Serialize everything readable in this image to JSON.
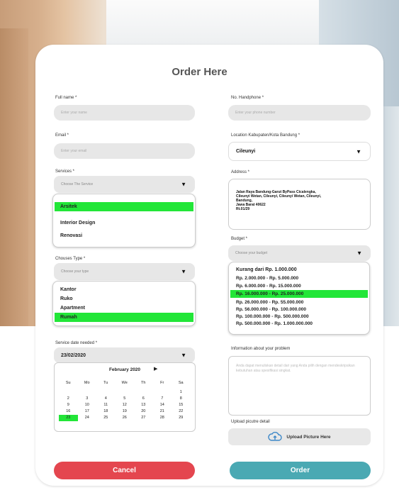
{
  "form": {
    "title": "Order Here",
    "full_name": {
      "label": "Full name *",
      "placeholder": "Enter your name"
    },
    "phone": {
      "label": "No. Handphone *",
      "placeholder": "Enter your phone number"
    },
    "email": {
      "label": "Email *",
      "placeholder": "Enter your email"
    },
    "location": {
      "label": "Location Kabupaten/Kota Bandung *",
      "value": "Cileunyi"
    },
    "services": {
      "label": "Services *",
      "placeholder": "Choose The Service",
      "options": [
        "Arsitek",
        "Interior Design",
        "Renovasi"
      ],
      "selected": "Arsitek"
    },
    "address": {
      "label": "Address *",
      "lines": [
        "Jalan Raya Bandung-Garut ByPass Cicalengka,",
        "Cileunyi Wetan, Cileunyi, Cileunyi Wetan, Cileunyi,",
        "Bandung,",
        "Jawa Barat 40622",
        "Rt.01/29"
      ]
    },
    "budget": {
      "label": "Budget *",
      "placeholder": "Choose your budget",
      "options": [
        "Kurang dari Rp. 1.000.000",
        "Rp. 2.000.000 - Rp. 5.000.000",
        "Rp. 6.000.000 - Rp. 15.000.000",
        "Rp. 16.000.000 - Rp. 25.000.000",
        "Rp. 26.000.000 - Rp. 55.000.000",
        "Rp. 56.000.000 - Rp. 100.000.000",
        "Rp. 100.000.000 - Rp. 500.000.000",
        "Rp. 500.000.000 - Rp. 1.000.000.000"
      ],
      "selected_index": 3
    },
    "type": {
      "label": "Chouses Type *",
      "placeholder": "Choose your type",
      "options": [
        "Kantor",
        "Ruko",
        "Apartment",
        "Rumah"
      ],
      "selected_index": 3
    },
    "problem": {
      "label": "Information about your problem",
      "placeholder": "Anda dapat menuliskan detail dari yang Anda pilih dengan mendeskripsikan kebutuhan atau spesifikasi singkat."
    },
    "date": {
      "label": "Service date needed *",
      "value": "23/02/2020",
      "calendar": {
        "month": "February 2020",
        "next": "▶",
        "days": [
          "Su",
          "Mo",
          "Tu",
          "We",
          "Th",
          "Fr",
          "Sa"
        ],
        "weeks": [
          [
            "",
            "",
            "",
            "",
            "",
            "",
            "1"
          ],
          [
            "2",
            "3",
            "4",
            "5",
            "6",
            "7",
            "8"
          ],
          [
            "9",
            "10",
            "11",
            "12",
            "13",
            "14",
            "15"
          ],
          [
            "16",
            "17",
            "18",
            "19",
            "20",
            "21",
            "22"
          ],
          [
            "23",
            "24",
            "25",
            "26",
            "27",
            "28",
            "29"
          ]
        ],
        "selected_day": "23"
      }
    },
    "upload": {
      "label": "Upload picutre detail",
      "button": "Upload Picture Here"
    },
    "cancel": "Cancel",
    "order": "Order"
  },
  "colors": {
    "selected": "#22e638",
    "cancel": "#e4464f",
    "order": "#4aa9b3"
  }
}
